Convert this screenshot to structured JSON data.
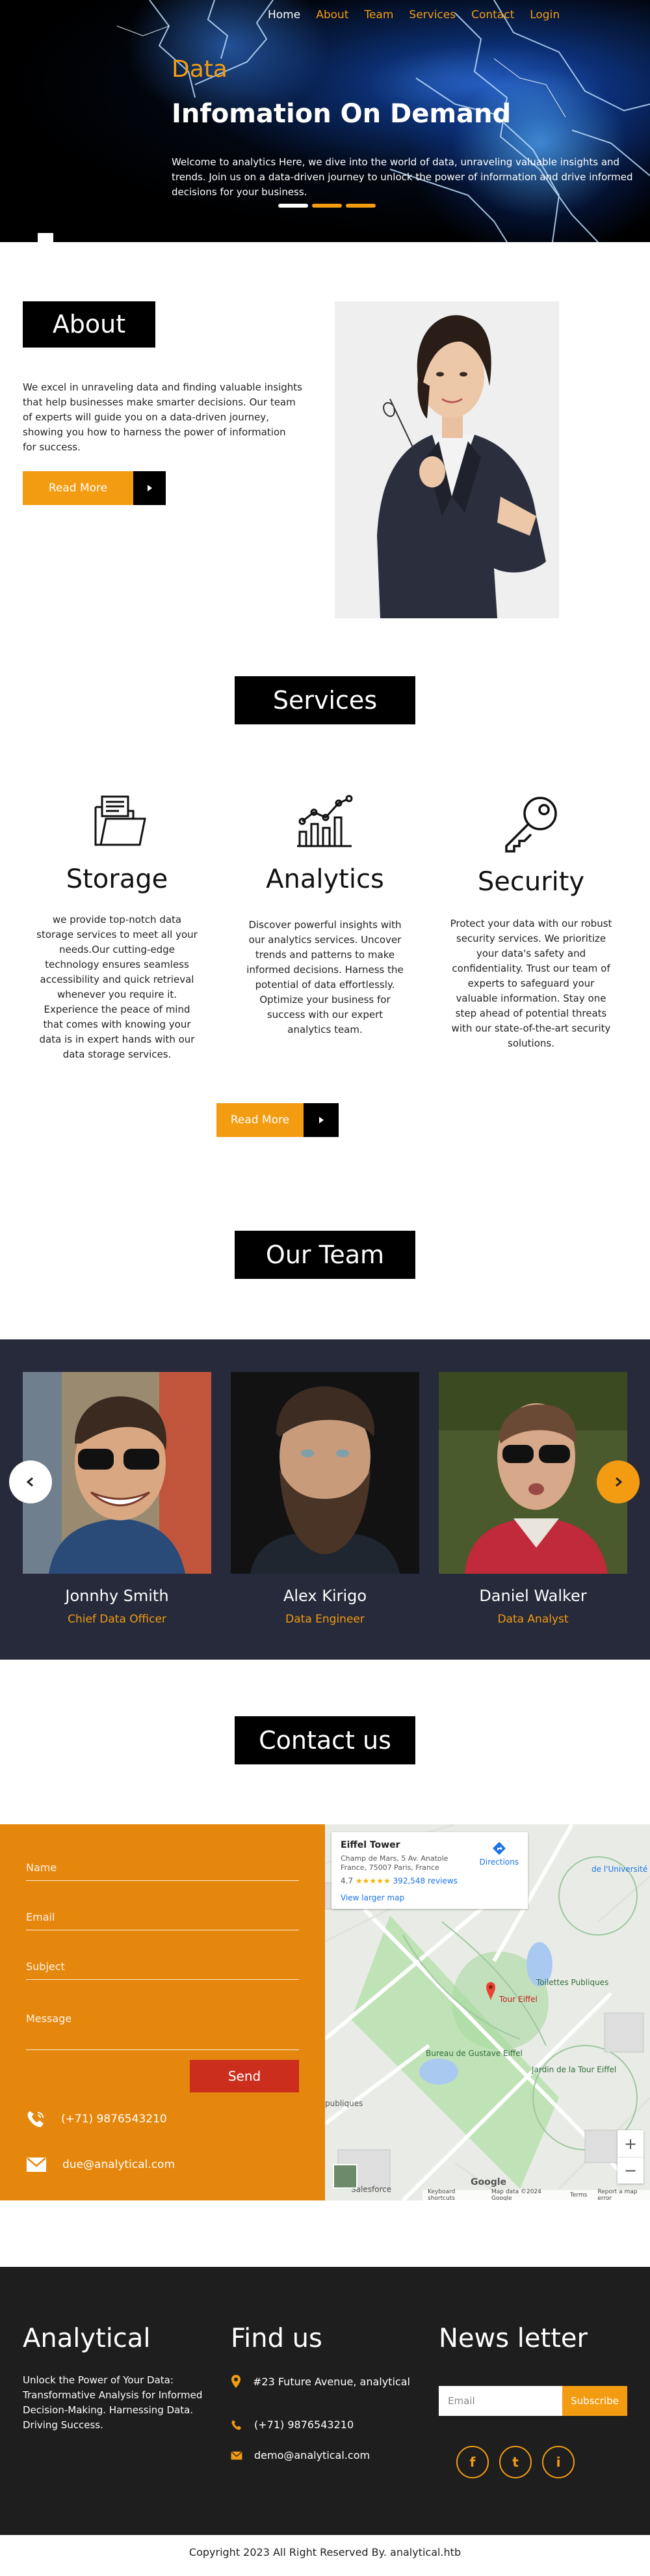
{
  "nav": {
    "items": [
      "Home",
      "About",
      "Team",
      "Services",
      "Contact",
      "Login"
    ]
  },
  "hero": {
    "eyebrow": "Data",
    "title": "Infomation On Demand",
    "text": "Welcome to analytics Here, we dive into the world of data, unraveling valuable insights and trends. Join us on a data-driven journey to unlock the power of information and drive informed decisions for your business."
  },
  "about": {
    "title": "About",
    "text": "We excel in unraveling data and finding valuable insights that help businesses make smarter decisions. Our team of experts will guide you on a data-driven journey, showing you how to harness the power of information for success.",
    "button": "Read More"
  },
  "services": {
    "title": "Services",
    "items": [
      {
        "name": "Storage",
        "icon": "folder-icon",
        "text": "we provide top-notch data storage services to meet all your needs.Our cutting-edge technology ensures seamless accessibility and quick retrieval whenever you require it. Experience the peace of mind that comes with knowing your data is in expert hands with our data storage services."
      },
      {
        "name": "Analytics",
        "icon": "bar-chart-icon",
        "text": "Discover powerful insights with our analytics services. Uncover trends and patterns to make informed decisions. Harness the potential of data effortlessly. Optimize your business for success with our expert analytics team."
      },
      {
        "name": "Security",
        "icon": "key-icon",
        "text": "Protect your data with our robust security services. We prioritize your data's safety and confidentiality. Trust our team of experts to safeguard your valuable information. Stay one step ahead of potential threats with our state-of-the-art security solutions."
      }
    ],
    "button": "Read More"
  },
  "team": {
    "title": "Our Team",
    "members": [
      {
        "name": "Jonnhy Smith",
        "role": "Chief Data Officer"
      },
      {
        "name": "Alex Kirigo",
        "role": "Data Engineer"
      },
      {
        "name": "Daniel Walker",
        "role": "Data Analyst"
      }
    ]
  },
  "contact": {
    "title": "Contact us",
    "placeholders": {
      "name": "Name",
      "email": "Email",
      "subject": "Subject",
      "message": "Message"
    },
    "send": "Send",
    "phone": "(+71) 9876543210",
    "email": "due@analytical.com"
  },
  "map": {
    "place": "Eiffel Tower",
    "address": "Champ de Mars, 5 Av. Anatole France, 75007 Paris, France",
    "rating": "4.7",
    "stars": "★★★★★",
    "reviews": "392,548 reviews",
    "larger": "View larger map",
    "directions": "Directions",
    "labels": {
      "tour": "Tour Eiffel",
      "toilettes": "Toilettes Publiques",
      "jardin": "Jardin de la Tour Eiffel",
      "bureau": "Bureau de Gustave Eiffel",
      "universite": "de l'Université",
      "salesforce": "Salesforce",
      "publiques": "publiques"
    },
    "footer": [
      "Keyboard shortcuts",
      "Map data ©2024 Google",
      "Terms",
      "Report a map error"
    ],
    "brand": "Google"
  },
  "footer": {
    "brand": "Analytical",
    "brand_text": "Unlock the Power of Your Data: Transformative Analysis for Informed Decision-Making. Harnessing Data. Driving Success.",
    "find_title": "Find us",
    "address": "#23 Future Avenue, analytical",
    "phone": "(+71) 9876543210",
    "email": "demo@analytical.com",
    "news_title": "News letter",
    "news_placeholder": "Email",
    "subscribe": "Subscribe",
    "social": [
      "f",
      "t",
      "i"
    ],
    "copyright": "Copyright 2023 All Right Reserved By. analytical.htb"
  },
  "colors": {
    "accent": "#f39c12",
    "dark": "#000000",
    "team_bg": "#262a3a",
    "footer_bg": "#1e1e1e",
    "form_bg": "#e6870d",
    "send": "#cc2e1e"
  }
}
